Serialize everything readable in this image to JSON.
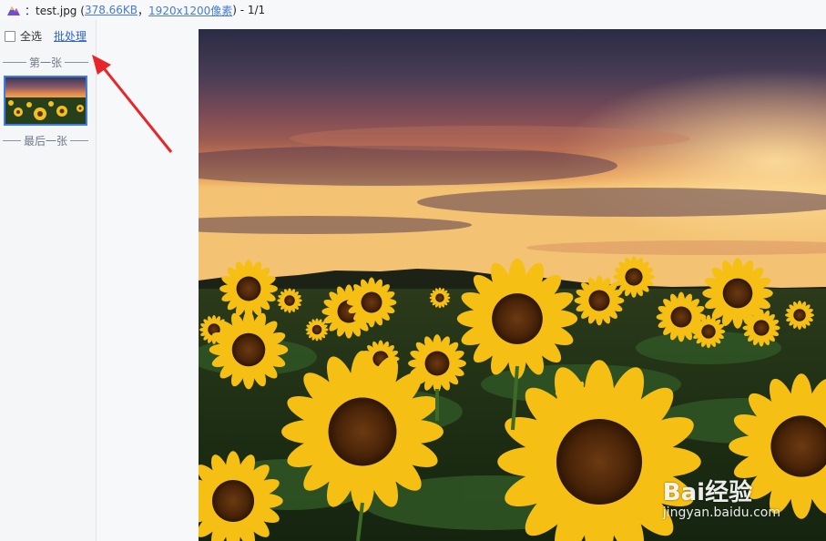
{
  "titlebar": {
    "icon": "app-mountain-icon",
    "prefix": "：test.jpg (",
    "filesize": "378.66KB",
    "separator": "，",
    "dimensions": "1920x1200像素",
    "suffix": ") - 1/1"
  },
  "sidebar": {
    "select_all_label": "全选",
    "select_all_checked": false,
    "batch_label": "批处理",
    "first_label": "第一张",
    "last_label": "最后一张",
    "thumbnail": "sunflower-field-thumbnail"
  },
  "main": {
    "image": "sunflower-field-at-sunset"
  },
  "watermark": {
    "text": "Bai经验",
    "url": "jingyan.baidu.com"
  },
  "annotation": {
    "arrow_color": "#e8262a"
  }
}
